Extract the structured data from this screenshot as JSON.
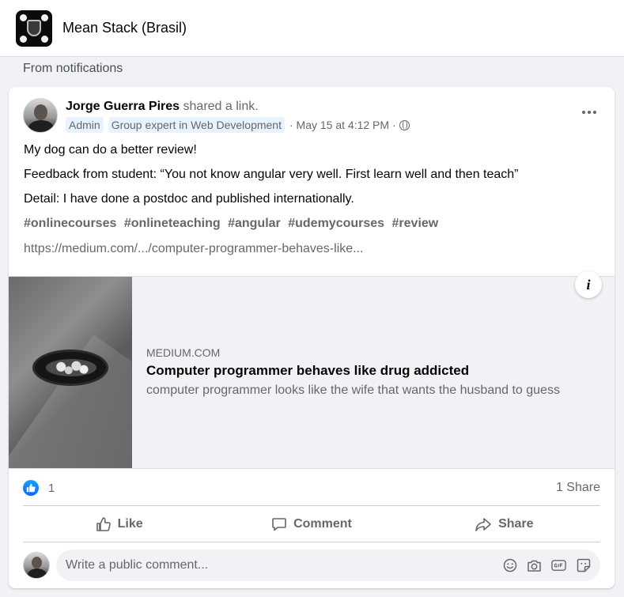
{
  "group": {
    "title": "Mean Stack (Brasil)"
  },
  "section_label": "From notifications",
  "post": {
    "author": "Jorge Guerra Pires",
    "action": " shared a link.",
    "badges": [
      "Admin",
      "Group expert in Web Development"
    ],
    "timestamp": "· May 15 at 4:12 PM ·",
    "text_lines": [
      "My dog can do a better review!",
      "Feedback from student: “You not know angular very well. First learn well and then teach”",
      "Detail: I have done a postdoc and published internationally."
    ],
    "hashtags": [
      "#onlinecourses",
      "#onlineteaching",
      "#angular",
      "#udemycourses",
      "#review"
    ],
    "link_text": "https://medium.com/.../computer-programmer-behaves-like..."
  },
  "preview": {
    "domain": "MEDIUM.COM",
    "title": "Computer programmer behaves like drug addicted",
    "description": "computer programmer looks like the wife that wants the husband to guess",
    "info_glyph": "i"
  },
  "stats": {
    "reactions": "1",
    "shares": "1 Share"
  },
  "actions": {
    "like": "Like",
    "comment": "Comment",
    "share": "Share"
  },
  "comment_box": {
    "placeholder": "Write a public comment..."
  },
  "icons": [
    "group-logo",
    "globe-icon",
    "more-icon",
    "info-icon",
    "like-reaction-icon",
    "thumbs-up-icon",
    "comment-bubble-icon",
    "share-arrow-icon",
    "emoji-icon",
    "camera-icon",
    "gif-icon",
    "sticker-icon"
  ],
  "colors": {
    "accent": "#0866ff",
    "secondary_text": "#65676b",
    "background": "#f0f2f5"
  }
}
